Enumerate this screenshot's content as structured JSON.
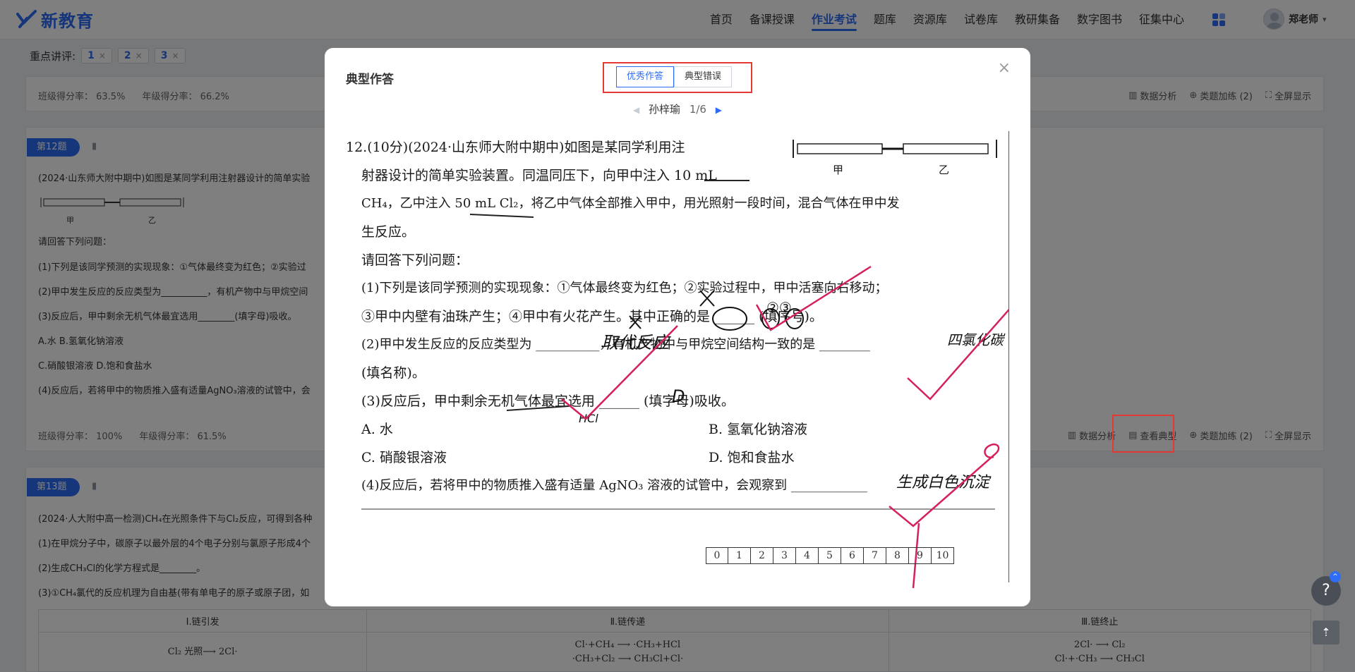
{
  "header": {
    "logo_text": "新教育",
    "nav": [
      "首页",
      "备课授课",
      "作业考试",
      "题库",
      "资源库",
      "试卷库",
      "教研集备",
      "数字图书",
      "征集中心"
    ],
    "active_nav": "作业考试",
    "user_name": "郑老师",
    "user_caret": "▾"
  },
  "review": {
    "label": "重点讲评:",
    "chips": [
      "1",
      "2",
      "3"
    ],
    "chip_close": "×"
  },
  "card1": {
    "class_score": "班级得分率： 63.5%",
    "grade_score": "年级得分率： 66.2%",
    "tools": [
      "数据分析",
      "类题加练 (2)",
      "全屏显示"
    ]
  },
  "q12": {
    "tag": "第12题",
    "lines": [
      "(2024·山东师大附中期中)如图是某同学利用注射器设计的简单实验",
      "请回答下列问题：",
      "(1)下列是该同学预测的实现现象：①气体最终变为红色；②实验过",
      "(2)甲中发生反应的反应类型为__________，有机产物中与甲烷空间",
      "(3)反应后，甲中剩余无机气体最宜选用________(填字母)吸收。",
      "A.水 B.氢氧化钠溶液",
      "C.硝酸银溶液 D.饱和食盐水",
      "(4)反应后，若将甲中的物质推入盛有适量AgNO₃溶液的试管中，会"
    ],
    "mini_labels": [
      "甲",
      "乙"
    ],
    "class_score": "班级得分率： 100%",
    "grade_score": "年级得分率： 61.5%",
    "tools": [
      "数据分析",
      "查看典型",
      "类题加练 (2)",
      "全屏显示"
    ]
  },
  "q13": {
    "tag": "第13题",
    "lines": [
      "(2024·人大附中高一检测)CH₄在光照条件下与Cl₂反应，可得到各种",
      "(1)在甲烷分子中，碳原子以最外层的4个电子分别与氯原子形成4个",
      "(2)生成CH₃Cl的化学方程式是________。",
      "(3)①CH₄氯代的反应机理为自由基(带有单电子的原子或原子团，如"
    ],
    "table_head": [
      "Ⅰ.链引发",
      "Ⅱ.链传递",
      "Ⅲ.链终止"
    ],
    "table_body": [
      [
        "Cl₂ 光照⟶ 2Cl·"
      ],
      [
        "Cl·+CH₄ ⟶ ·CH₃+HCl",
        "·CH₃+Cl₂ ⟶ CH₃Cl+Cl·"
      ],
      [
        "2Cl· ⟶ Cl₂",
        "Cl·+·CH₃ ⟶ CH₃Cl"
      ]
    ]
  },
  "modal": {
    "title": "典型作答",
    "close": "×",
    "tabs": [
      "优秀作答",
      "典型错误"
    ],
    "active_tab": "优秀作答",
    "student": "孙梓瑜",
    "page": "1/6",
    "prev_arrow": "◀",
    "next_arrow": "▶",
    "scan_lines": [
      "12.(10分)(2024·山东师大附中期中)如图是某同学利用注",
      "射器设计的简单实验装置。同温同压下，向甲中注入 10 mL",
      "CH₄，乙中注入 50 mL Cl₂，将乙中气体全部推入甲中，用光照射一段时间，混合气体在甲中发",
      "生反应。",
      "请回答下列问题：",
      "(1)下列是该同学预测的实现现象：①气体最终变为红色；②实验过程中，甲中活塞向右移动；",
      "③甲中内壁有油珠产生；④甲中有火花产生。其中正确的是 ______ (填序号)。",
      "(2)甲中发生反应的反应类型为 __________，有机产物中与甲烷空间结构一致的是 ________",
      "(填名称)。",
      "(3)反应后，甲中剩余无机气体最宜选用 ______ (填字母)吸收。",
      "A. 水",
      "B. 氢氧化钠溶液",
      "C. 硝酸银溶液",
      "D. 饱和食盐水",
      "(4)反应后，若将甲中的物质推入盛有适量 AgNO₃ 溶液的试管中，会观察到 ____________"
    ],
    "device_labels": [
      "甲",
      "乙"
    ],
    "handwriting": [
      "②③",
      "取代反应",
      "四氯化碳",
      "D",
      "HCl",
      "生成白色沉淀"
    ],
    "scores": [
      "0",
      "1",
      "2",
      "3",
      "4",
      "5",
      "6",
      "7",
      "8",
      "9",
      "10"
    ]
  },
  "float": {
    "help": "?",
    "help_badge": "^",
    "top": "⇡"
  },
  "colors": {
    "brand": "#2d6df6",
    "highlight": "#e53935",
    "check": "#d6205a"
  }
}
